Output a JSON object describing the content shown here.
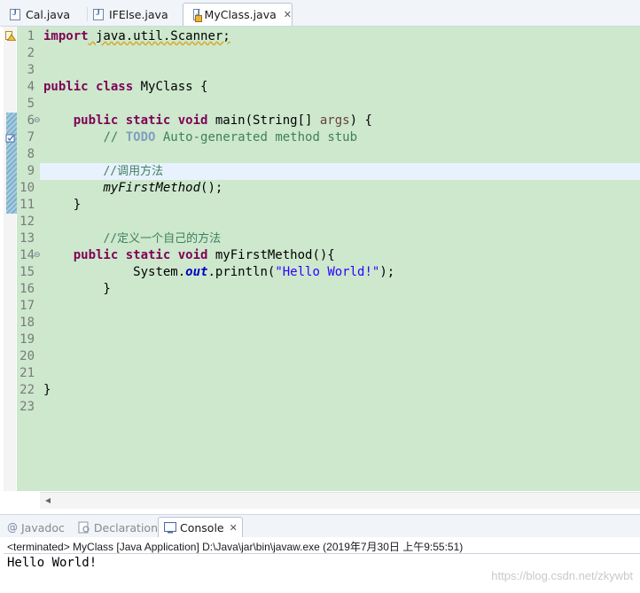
{
  "editor_tabs": [
    {
      "label": "Cal.java",
      "active": false
    },
    {
      "label": "IFElse.java",
      "active": false
    },
    {
      "label": "MyClass.java",
      "active": true,
      "close": "✕"
    }
  ],
  "code_lines": [
    {
      "n": "1"
    },
    {
      "n": "2"
    },
    {
      "n": "3"
    },
    {
      "n": "4"
    },
    {
      "n": "5"
    },
    {
      "n": "6"
    },
    {
      "n": "7"
    },
    {
      "n": "8"
    },
    {
      "n": "9"
    },
    {
      "n": "10"
    },
    {
      "n": "11"
    },
    {
      "n": "12"
    },
    {
      "n": "13"
    },
    {
      "n": "14"
    },
    {
      "n": "15"
    },
    {
      "n": "16"
    },
    {
      "n": "17"
    },
    {
      "n": "18"
    },
    {
      "n": "19"
    },
    {
      "n": "20"
    },
    {
      "n": "21"
    },
    {
      "n": "22"
    },
    {
      "n": "23"
    }
  ],
  "code": {
    "l1_kw": "import",
    "l1_rest": " java.util.Scanner;",
    "l4_kw": "public class",
    "l4_rest": " MyClass {",
    "l6_indent": "    ",
    "l6_kw": "public static void",
    "l6_a": " main(String[] ",
    "l6_args": "args",
    "l6_b": ") {",
    "l7_indent": "        ",
    "l7_c1": "// ",
    "l7_todo": "TODO",
    "l7_c2": " Auto-generated method stub",
    "l9_indent": "        ",
    "l9_comment": "//调用方法",
    "l10_indent": "        ",
    "l10_call": "myFirstMethod",
    "l10_rest": "();",
    "l11_text": "    }",
    "l13_indent": "        ",
    "l13_comment": "//定义一个自己的方法",
    "l14_indent": "    ",
    "l14_kw": "public static void",
    "l14_rest": " myFirstMethod(){",
    "l15_indent": "            ",
    "l15_a": "System.",
    "l15_out": "out",
    "l15_b": ".println(",
    "l15_str": "\"Hello World!\"",
    "l15_c": ");",
    "l16_text": "        }",
    "l22_text": "}"
  },
  "panel_tabs": [
    {
      "label": "Javadoc",
      "icon": "@"
    },
    {
      "label": "Declaration",
      "icon": "declaration-icon"
    },
    {
      "label": "Console",
      "icon": "console-icon",
      "close": "✕"
    }
  ],
  "console": {
    "terminated": "<terminated> MyClass [Java Application] D:\\Java\\jar\\bin\\javaw.exe (2019年7月30日 上午9:55:51)",
    "output": "Hello World!"
  },
  "watermark": "https://blog.csdn.net/zkywbt",
  "colors": {
    "keyword": "#7f0055",
    "comment": "#3f7f5f",
    "string": "#2a00ff",
    "editor_background": "#cde8cd",
    "current_line": "#e8f2fe"
  }
}
